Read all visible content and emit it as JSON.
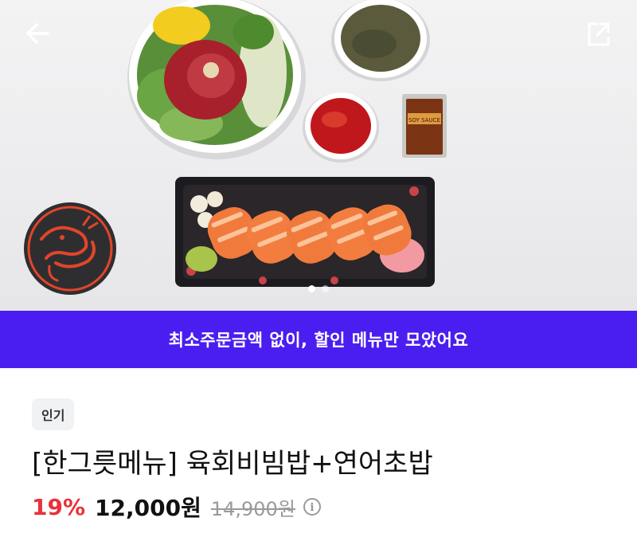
{
  "header": {
    "back_icon": "arrow-left-icon",
    "share_icon": "share-icon"
  },
  "hero": {
    "slide_count": 2,
    "active_slide": 1
  },
  "banner": {
    "text": "최소주문금액 없이, 할인 메뉴만 모았어요",
    "color": "#4a1ef0"
  },
  "product": {
    "tag": "인기",
    "title": "[한그릇메뉴] 육회비빔밥+연어초밥",
    "discount": "19%",
    "price": "12,000원",
    "original_price": "14,900원",
    "info_icon": "i"
  },
  "sauce_packet": {
    "label": "SOY SAUCE"
  },
  "colors": {
    "discount": "#e8323c",
    "accent": "#4a1ef0"
  }
}
